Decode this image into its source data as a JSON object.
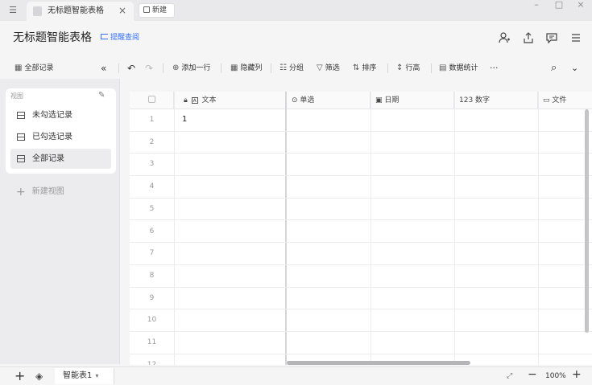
{
  "window": {
    "tab_title": "无标题智能表格",
    "tab_close": "×",
    "new_tab_label": "新建",
    "controls": {
      "minimize": "–",
      "maximize": "□",
      "close": "×"
    }
  },
  "header": {
    "doc_title": "无标题智能表格",
    "remind_label": "提醒查阅",
    "icons": [
      "add-user-icon",
      "share-icon",
      "comment-icon",
      "menu-icon"
    ]
  },
  "toolbar": {
    "view_name": "全部记录",
    "collapse": "«",
    "undo": "↶",
    "redo": "↷",
    "add_row": "添加一行",
    "hide_col": "隐藏列",
    "group": "分组",
    "filter": "筛选",
    "sort": "排序",
    "row_height": "行高",
    "stats": "数据统计",
    "more": "···",
    "search": "⌕",
    "expand": "⌄"
  },
  "sidebar": {
    "section_label": "视图",
    "views": [
      {
        "label": "未勾选记录",
        "active": false
      },
      {
        "label": "已勾选记录",
        "active": false
      },
      {
        "label": "全部记录",
        "active": true
      }
    ],
    "new_view": "新建视图"
  },
  "grid": {
    "columns": [
      {
        "label": "文本",
        "icon": "text-field-icon"
      },
      {
        "label": "单选",
        "icon": "single-select-icon"
      },
      {
        "label": "日期",
        "icon": "date-icon"
      },
      {
        "label": "123 数字",
        "icon": "number-icon"
      },
      {
        "label": "文件",
        "icon": "file-icon"
      }
    ],
    "rows": [
      {
        "num": "1",
        "text": "1"
      },
      {
        "num": "2",
        "text": ""
      },
      {
        "num": "3",
        "text": ""
      },
      {
        "num": "4",
        "text": ""
      },
      {
        "num": "5",
        "text": ""
      },
      {
        "num": "6",
        "text": ""
      },
      {
        "num": "7",
        "text": ""
      },
      {
        "num": "8",
        "text": ""
      },
      {
        "num": "9",
        "text": ""
      },
      {
        "num": "10",
        "text": ""
      },
      {
        "num": "11",
        "text": ""
      },
      {
        "num": "12",
        "text": ""
      }
    ]
  },
  "footer": {
    "add": "+",
    "sheet_name": "智能表1",
    "sheet_caret": "▾",
    "zoom_out": "−",
    "zoom": "100%",
    "zoom_in": "+"
  },
  "colors": {
    "accent": "#3370ff",
    "active_view_bg": "#ececee"
  }
}
